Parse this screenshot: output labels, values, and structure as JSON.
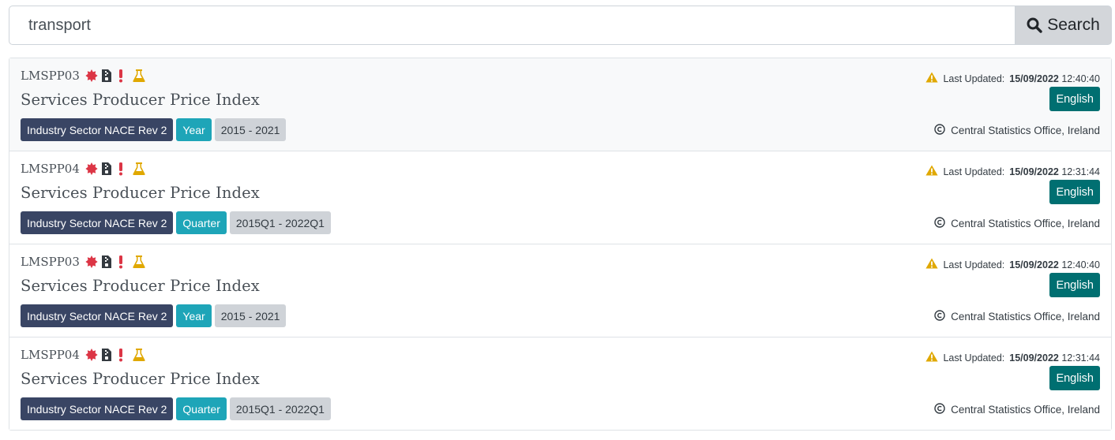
{
  "search": {
    "value": "transport",
    "button_label": "Search"
  },
  "colors": {
    "dimension_badge": "#394564",
    "frequency_badge": "#1ea5b8",
    "range_badge": "#cfd3d8",
    "language_button": "#006f71",
    "warning": "#e0a800",
    "danger": "#dc3545"
  },
  "icons": [
    "starburst-icon",
    "archive-file-icon",
    "exclamation-icon",
    "flask-icon",
    "warning-icon",
    "copyright-icon",
    "search-icon"
  ],
  "results": [
    {
      "code": "LMSPP03",
      "title": "Services Producer Price Index",
      "dimension": "Industry Sector NACE Rev 2",
      "frequency": "Year",
      "range": "2015 - 2021",
      "updated_label": "Last Updated:",
      "updated_date": "15/09/2022",
      "updated_time": "12:40:40",
      "language": "English",
      "copyright": "Central Statistics Office, Ireland"
    },
    {
      "code": "LMSPP04",
      "title": "Services Producer Price Index",
      "dimension": "Industry Sector NACE Rev 2",
      "frequency": "Quarter",
      "range": "2015Q1 - 2022Q1",
      "updated_label": "Last Updated:",
      "updated_date": "15/09/2022",
      "updated_time": "12:31:44",
      "language": "English",
      "copyright": "Central Statistics Office, Ireland"
    },
    {
      "code": "LMSPP03",
      "title": "Services Producer Price Index",
      "dimension": "Industry Sector NACE Rev 2",
      "frequency": "Year",
      "range": "2015 - 2021",
      "updated_label": "Last Updated:",
      "updated_date": "15/09/2022",
      "updated_time": "12:40:40",
      "language": "English",
      "copyright": "Central Statistics Office, Ireland"
    },
    {
      "code": "LMSPP04",
      "title": "Services Producer Price Index",
      "dimension": "Industry Sector NACE Rev 2",
      "frequency": "Quarter",
      "range": "2015Q1 - 2022Q1",
      "updated_label": "Last Updated:",
      "updated_date": "15/09/2022",
      "updated_time": "12:31:44",
      "language": "English",
      "copyright": "Central Statistics Office, Ireland"
    }
  ]
}
